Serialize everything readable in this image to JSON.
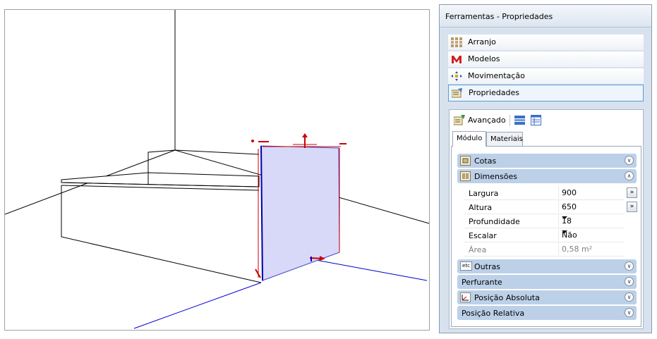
{
  "panel": {
    "title": "Ferramentas - Propriedades",
    "nav_items": [
      {
        "label": "Arranjo",
        "icon": "arranjo-grid-icon"
      },
      {
        "label": "Modelos",
        "icon": "modelos-m-icon"
      },
      {
        "label": "Movimentação",
        "icon": "move-arrows-icon"
      },
      {
        "label": "Propriedades",
        "icon": "properties-icon",
        "selected": true
      }
    ],
    "toolbar": {
      "advanced_label": "Avançado"
    },
    "tabs": [
      {
        "label": "Módulo",
        "active": true
      },
      {
        "label": "Materiais",
        "active": false
      }
    ],
    "sections": {
      "cotas": "Cotas",
      "dimensoes": "Dimensões",
      "outras": "Outras",
      "perfurante": "Perfurante",
      "posicao_absoluta": "Posição Absoluta",
      "posicao_relativa": "Posição Relativa"
    },
    "properties": [
      {
        "name": "Largura",
        "value": "900",
        "control": "button",
        "button_label": "»"
      },
      {
        "name": "Altura",
        "value": "650",
        "control": "button",
        "button_label": "»"
      },
      {
        "name": "Profundidade",
        "value": "18",
        "control": "dropdown"
      },
      {
        "name": "Escalar",
        "value": "Não",
        "control": "dropdown"
      },
      {
        "name": "Área",
        "value": "0,58 m²",
        "control": "readonly"
      }
    ],
    "icon_labels": {
      "outras": "etc"
    }
  },
  "colors": {
    "panel_bg": "#d8e2ee",
    "section_header": "#bcd0e8",
    "selected_panel_fill": "#d8d8f8",
    "gizmo_red": "#cc0000",
    "axis_blue": "#0000cc"
  }
}
